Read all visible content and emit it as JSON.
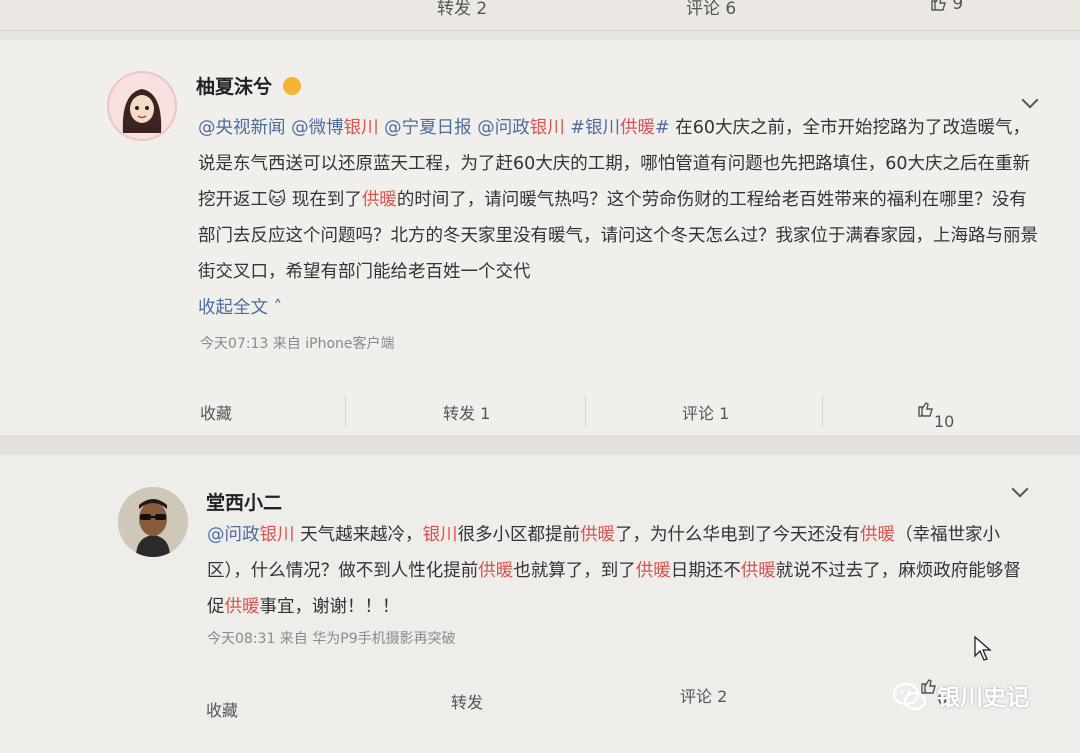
{
  "top_bar": {
    "repost": "转发 2",
    "comment": "评论 6",
    "like": "9"
  },
  "post1": {
    "username": "柚夏沫兮",
    "badge_icon": "crown-emoji",
    "text_segments": [
      {
        "t": "@央视新闻",
        "c": "at"
      },
      {
        "t": " ",
        "c": ""
      },
      {
        "t": "@微博",
        "c": "at"
      },
      {
        "t": "银川",
        "c": "red"
      },
      {
        "t": " ",
        "c": ""
      },
      {
        "t": "@宁夏日报",
        "c": "at"
      },
      {
        "t": " ",
        "c": ""
      },
      {
        "t": "@问政",
        "c": "at"
      },
      {
        "t": "银川",
        "c": "red"
      },
      {
        "t": " ",
        "c": ""
      },
      {
        "t": "#银川",
        "c": "at"
      },
      {
        "t": "供暖",
        "c": "red"
      },
      {
        "t": "#",
        "c": "at"
      },
      {
        "t": " 在60大庆之前，全市开始挖路为了改造暖气，说是东气西送可以还原蓝天工程，为了赶60大庆的工期，哪怕管道有问题也先把路填住，60大庆之后在重新挖开返工",
        "c": ""
      },
      {
        "t": "🐱",
        "c": "emoji"
      },
      {
        "t": " 现在到了",
        "c": ""
      },
      {
        "t": "供暖",
        "c": "red"
      },
      {
        "t": "的时间了，请问暖气热吗？这个劳命伤财的工程给老百姓带来的福利在哪里？没有部门去反应这个问题吗？北方的冬天家里没有暖气，请问这个冬天怎么过？我家位于满春家园，上海路与丽景街交叉口，希望有部门能给老百姓一个交代",
        "c": ""
      }
    ],
    "collapse": "收起全文",
    "time_source": "今天07:13 来自 iPhone客户端",
    "actions": {
      "favorite": "收藏",
      "repost": "转发 1",
      "comment": "评论 1",
      "like": "10"
    }
  },
  "post2": {
    "username": "堂西小二",
    "text_segments": [
      {
        "t": "@问政",
        "c": "at"
      },
      {
        "t": "银川",
        "c": "red"
      },
      {
        "t": " 天气越来越冷，",
        "c": ""
      },
      {
        "t": "银川",
        "c": "red"
      },
      {
        "t": "很多小区都提前",
        "c": ""
      },
      {
        "t": "供暖",
        "c": "red"
      },
      {
        "t": "了，为什么华电到了今天还没有",
        "c": ""
      },
      {
        "t": "供暖",
        "c": "red"
      },
      {
        "t": "（幸福世家小区），什么情况？做不到人性化提前",
        "c": ""
      },
      {
        "t": "供暖",
        "c": "red"
      },
      {
        "t": "也就算了，到了",
        "c": ""
      },
      {
        "t": "供暖",
        "c": "red"
      },
      {
        "t": "日期还不",
        "c": ""
      },
      {
        "t": "供暖",
        "c": "red"
      },
      {
        "t": "就说不过去了，麻烦政府能够督促",
        "c": ""
      },
      {
        "t": "供暖",
        "c": "red"
      },
      {
        "t": "事宜，谢谢！！！",
        "c": ""
      }
    ],
    "time_source": "今天08:31 来自 华为P9手机摄影再突破",
    "actions": {
      "favorite": "收藏",
      "repost": "转发",
      "comment": "评论 2",
      "like": "6"
    }
  },
  "watermark": "银川史记",
  "colors": {
    "link": "#4c6d9e",
    "keyword": "#d9534f"
  }
}
